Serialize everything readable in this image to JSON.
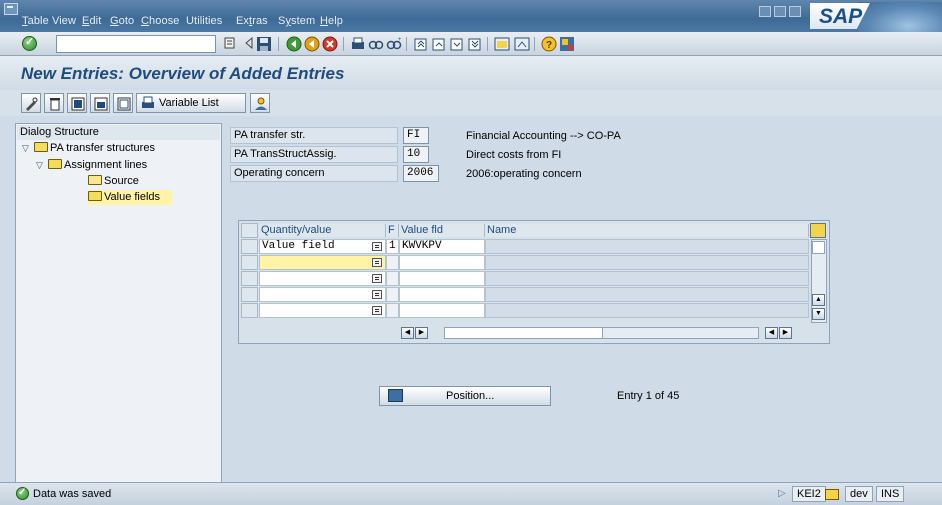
{
  "menubar": {
    "items": [
      {
        "label": "Table View",
        "mnemonic_index": 0
      },
      {
        "label": "Edit",
        "mnemonic_index": 0
      },
      {
        "label": "Goto",
        "mnemonic_index": 0
      },
      {
        "label": "Choose",
        "mnemonic_index": 0
      },
      {
        "label": "Utilities",
        "mnemonic_index": -1
      },
      {
        "label": "Extras",
        "mnemonic_index": 2
      },
      {
        "label": "System",
        "mnemonic_index": 1
      },
      {
        "label": "Help",
        "mnemonic_index": 0
      }
    ],
    "logo": "SAP"
  },
  "toolbar": {
    "command_field_value": ""
  },
  "title": "New Entries: Overview of Added Entries",
  "app_toolbar": {
    "variable_list_label": "Variable List"
  },
  "dialog_structure": {
    "title": "Dialog Structure",
    "items": [
      {
        "label": "PA transfer structures",
        "level": 0,
        "expanded": true
      },
      {
        "label": "Assignment lines",
        "level": 1,
        "expanded": true
      },
      {
        "label": "Source",
        "level": 2
      },
      {
        "label": "Value fields",
        "level": 2,
        "selected": true
      }
    ]
  },
  "header_fields": {
    "pa_transfer_str": {
      "label": "PA transfer str.",
      "value": "FI",
      "description": "Financial Accounting --> CO-PA"
    },
    "trans_struct_assig": {
      "label": "PA TransStructAssig.",
      "value": "10",
      "description": "Direct costs from FI"
    },
    "operating_concern": {
      "label": "Operating concern",
      "value": "2006",
      "description": "2006:operating concern"
    }
  },
  "table": {
    "columns": [
      "Quantity/value",
      "F",
      "Value fld",
      "Name"
    ],
    "rows": [
      {
        "quantity_value": "Value field",
        "f": "1",
        "value_fld": "KWVKPV",
        "name": ""
      },
      {
        "quantity_value": "",
        "f": "",
        "value_fld": "",
        "name": ""
      },
      {
        "quantity_value": "",
        "f": "",
        "value_fld": "",
        "name": ""
      },
      {
        "quantity_value": "",
        "f": "",
        "value_fld": "",
        "name": ""
      },
      {
        "quantity_value": "",
        "f": "",
        "value_fld": "",
        "name": ""
      }
    ]
  },
  "position_button": "Position...",
  "entry_info": "Entry 1 of 45",
  "statusbar": {
    "message": "Data was saved",
    "transaction": "KEI2",
    "client": "dev",
    "mode": "INS"
  }
}
